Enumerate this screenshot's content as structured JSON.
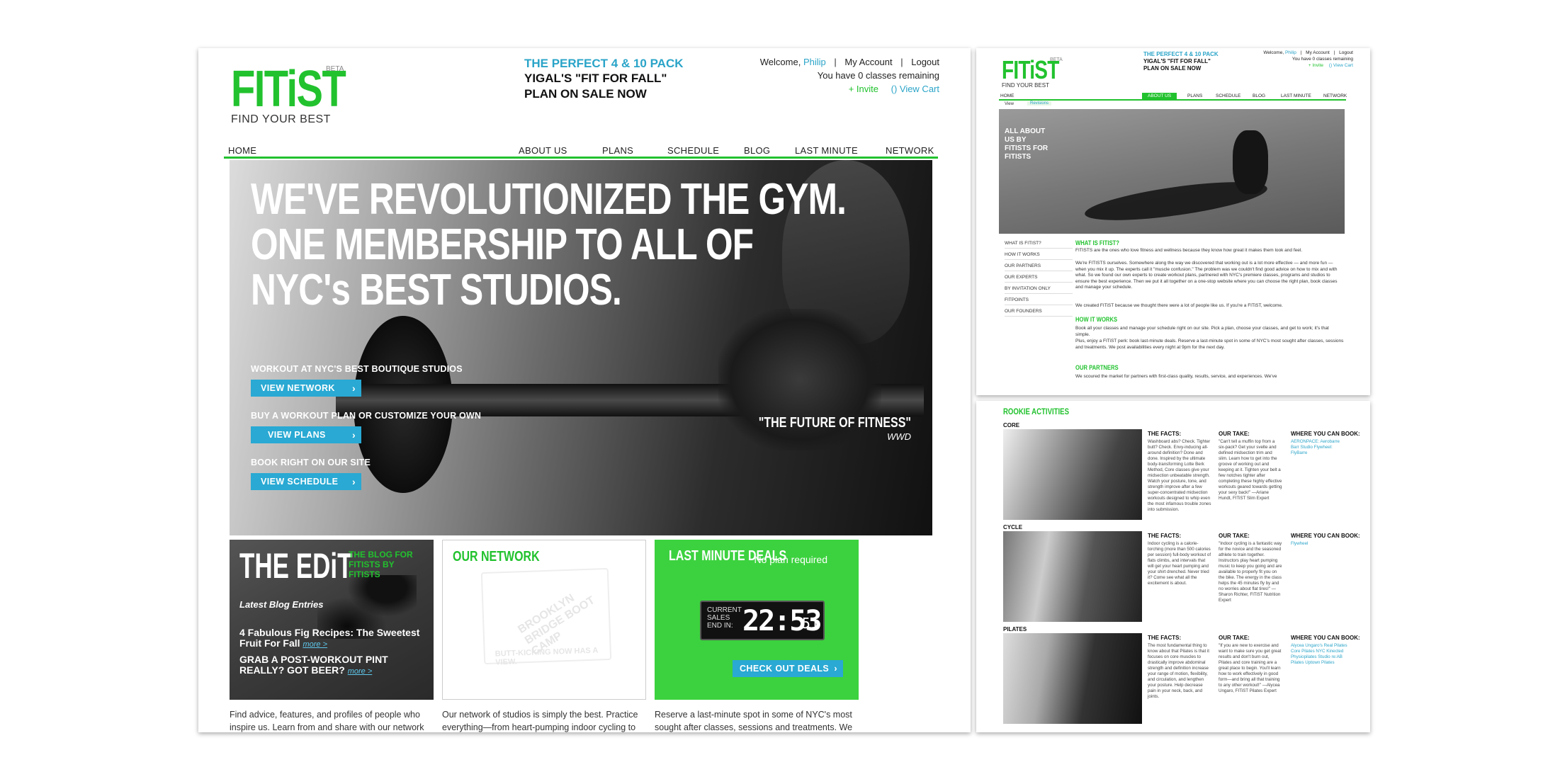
{
  "main": {
    "logo": "FITiST",
    "beta": "BETA",
    "tagline": "FIND YOUR BEST",
    "promo_line1": "THE PERFECT 4 & 10 PACK",
    "promo_line2": "YIGAL'S \"FIT FOR FALL\"",
    "promo_line3": "PLAN ON SALE NOW",
    "welcome": "Welcome,",
    "username": "Philip",
    "my_account": "My Account",
    "logout": "Logout",
    "classes_remaining": "You have 0 classes remaining",
    "invite": "+ Invite",
    "view_cart": "() View Cart",
    "nav": [
      "HOME",
      "ABOUT US",
      "PLANS",
      "SCHEDULE",
      "BLOG",
      "LAST MINUTE",
      "NETWORK"
    ],
    "hero_headline_1": "WE'VE REVOLUTIONIZED THE GYM.",
    "hero_headline_2": "ONE MEMBERSHIP TO ALL OF",
    "hero_headline_3": "NYC's BEST STUDIOS.",
    "hero_label_1": "WORKOUT AT NYC'S BEST BOUTIQUE STUDIOS",
    "hero_btn_1": "VIEW NETWORK",
    "hero_label_2": "BUY A WORKOUT PLAN OR CUSTOMIZE YOUR OWN",
    "hero_btn_2": "VIEW PLANS",
    "hero_label_3": "BOOK RIGHT ON OUR SITE",
    "hero_btn_3": "VIEW SCHEDULE",
    "quote": "\"THE FUTURE OF FITNESS\"",
    "quote_source": "WWD",
    "edit_title": "THE EDiT",
    "edit_side": "THE BLOG FOR FITISTS BY FITISTS",
    "edit_latest": "Latest Blog Entries",
    "edit_entry_1": "4 Fabulous Fig Recipes: The Sweetest Fruit For Fall",
    "edit_entry_2": "GRAB A POST-WORKOUT PINT REALLY? GOT BEER?",
    "more": "more >",
    "network_title": "OUR NETWORK",
    "network_badge_1": "BROOKLYN BRIDGE BOOT CAMP",
    "network_badge_2": "BUTT-KICKING NOW HAS A VIEW.",
    "deals_title": "LAST MINUTE DEALS",
    "deals_no_plan": "No plan required",
    "clock_label": "CURRENT SALES END IN:",
    "clock_time": "22:53",
    "clock_sec": "51",
    "deals_btn": "CHECK OUT DEALS",
    "desc_1": "Find advice, features, and profiles of people who inspire us. Learn from and share with our network of",
    "desc_2": "Our network of studios is simply the best. Practice everything—from heart-pumping indoor cycling to",
    "desc_3": "Reserve a last-minute spot in some of NYC's most sought after classes, sessions and treatments. We post availabilities every night at 9pm for"
  },
  "about": {
    "logo": "FITiST",
    "beta": "BETA",
    "tagline": "FIND YOUR BEST",
    "promo_line1": "THE PERFECT 4 & 10 PACK",
    "promo_line2": "YIGAL'S \"FIT FOR FALL\"",
    "promo_line3": "PLAN ON SALE NOW",
    "welcome": "Welcome,",
    "username": "Philip",
    "my_account": "My Account",
    "logout": "Logout",
    "classes_remaining": "You have 0 classes remaining",
    "invite": "+ Invite",
    "view_cart": "() View Cart",
    "nav": [
      "HOME",
      "ABOUT US",
      "PLANS",
      "SCHEDULE",
      "BLOG",
      "LAST MINUTE",
      "NETWORK"
    ],
    "subtab_view": "View",
    "subtab_revisions": "Revisions",
    "hero_text": "ALL ABOUT US BY FITISTS FOR FITISTS",
    "sidebar": [
      "WHAT IS FITIST?",
      "HOW IT WORKS",
      "OUR PARTNERS",
      "OUR EXPERTS",
      "BY INVITATION ONLY",
      "FITPOINTS",
      "OUR FOUNDERS"
    ],
    "h1": "WHAT IS FITIST?",
    "p1": "FITISTS are the ones who love fitness and wellness because they know how great it makes them look and feel.",
    "p2": "We're FITISTS ourselves. Somewhere along the way we discovered that working out is a lot more effective — and more fun — when you mix it up. The experts call it \"muscle confusion.\" The problem was we couldn't find good advice on how to mix and with what. So we found our own experts to create workout plans, partnered with NYC's premiere classes, programs and studios to ensure the best experience. Then we put it all together on a one-stop website where you can choose the right plan, book classes and manage your schedule.",
    "p3": "We created FITiST because we thought there were a lot of people like us. If you're a FITiST, welcome.",
    "h2": "HOW IT WORKS",
    "p4": "Book all your classes and manage your schedule right on our site. Pick a plan, choose your classes, and get to work; it's that simple.",
    "p5": "Plus, enjoy a FITiST perk: book last-minute deals. Reserve a last-minute spot in some of NYC's most sought after classes, sessions and treatments. We post availabilities every night at 9pm for the next day.",
    "h3": "OUR PARTNERS",
    "p6": "We scoured the market for partners with first-class quality, results, service, and experiences. We've"
  },
  "rookie": {
    "title": "ROOKIE ACTIVITIES",
    "facts_h": "THE FACTS:",
    "take_h": "OUR TAKE:",
    "book_h": "WHERE YOU CAN BOOK:",
    "rows": [
      {
        "label": "CORE",
        "facts": "Washboard abs? Check. Tighter butt? Check. Envy-inducing all-around definition? Done and done. Inspired by the ultimate body-transforming Lotte Berk Method, Core classes give your midsection unbeatable strength. Watch your posture, tone, and strength improve after a few super-concentrated midsection workouts designed to whip even the most infamous trouble zones into submission.",
        "take": "\"Can't tell a muffin top from a six-pack? Get your svelte and defined midsection trim and slim. Learn how to get into the groove of working out and keeping at it. Tighten your belt a few notches tighter after completing these highly effective workouts geared towards getting your sexy back!\" —Ariane Hundt, FITiST Slim Expert",
        "book": "AERONPACE: Aerobarre Barr Studio Flywheel: FlyBarre"
      },
      {
        "label": "CYCLE",
        "facts": "Indoor cycling is a calorie-torching (more than 500 calories per session) full-body workout of flats climbs, and intervals that will get your heart pumping and your shirt drenched. Never tried it? Come see what all the excitement is about.",
        "take": "\"Indoor cycling is a fantastic way for the novice and the seasoned athlete to train together. Instructors play heart pumping music to keep you going and are available to properly fit you on the bike. The energy in the class helps the 45 minutes fly by and no worries about flat tires!\" — Sharon Richter, FITiST Nutrition Expert",
        "book": "Flywheel"
      },
      {
        "label": "PILATES",
        "facts": "The most fundamental thing to know about that Pilates is that it focuses on core muscles to drastically improve abdominal strength and definition increase your range of motion, flexibility, and circulation, and lengthen your posture. Help decrease pain in your neck, back, and joints.",
        "take": "\"If you are new to exercise and want to make sure you get great results and don't burn out, Pilates and core training are a great place to begin. You'll learn how to work effectively in good form—and bring all that training to any other workout!\" —Alycea Ungaro, FITiST Pilates Expert",
        "book": "Alycea Ungaro's Real Pilates Core Pilates NYC Kinected Physiopilates Studio re:AB Pilates Uptown Pilates"
      }
    ]
  },
  "colors": {
    "brand_green": "#22c22e",
    "accent_blue": "#29a9d3",
    "deals_green": "#3cd23f"
  }
}
